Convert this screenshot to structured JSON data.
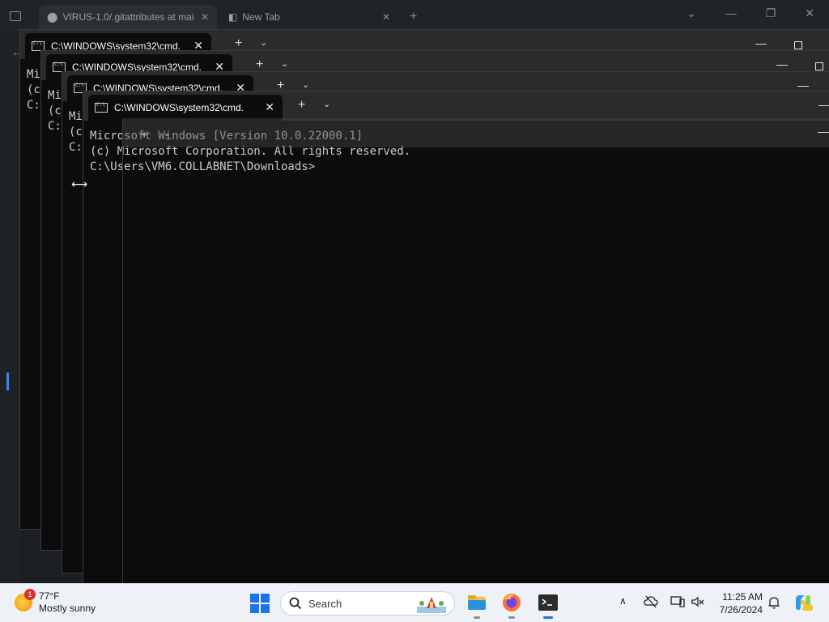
{
  "browser": {
    "tabs": [
      {
        "label": "VIRUS-1.0/.gitattributes at mai"
      },
      {
        "label": "New Tab"
      }
    ]
  },
  "terminals": [
    {
      "tab_title": "C:\\WINDOWS\\system32\\cmd.",
      "lines": [
        "Mi",
        "(c",
        "",
        "C:"
      ]
    },
    {
      "tab_title": "C:\\WINDOWS\\system32\\cmd.",
      "lines": [
        "Mi",
        "(c",
        "",
        "C:"
      ]
    },
    {
      "tab_title": "C:\\WINDOWS\\system32\\cmd.",
      "lines": [
        "Mi",
        "(c",
        "",
        "C:"
      ]
    },
    {
      "tab_title": "C:\\WINDOWS\\system32\\cmd.",
      "lines": [
        "Microsoft Windows [Version 10.0.22000.1]",
        "(c) Microsoft Corporation. All rights reserved.",
        "",
        "C:\\Users\\VM6.COLLABNET\\Downloads>"
      ]
    }
  ],
  "taskbar": {
    "weather": {
      "temp": "77°F",
      "condition": "Mostly sunny",
      "badge": "1"
    },
    "search_placeholder": "Search",
    "clock": {
      "time": "11:25 AM",
      "date": "7/26/2024"
    },
    "apps": [
      "file-explorer",
      "firefox",
      "terminal"
    ]
  },
  "colors": {
    "accent": "#1a73e8",
    "terminal_bg": "#0c0c0c",
    "taskbar_bg": "#eef1f5"
  }
}
